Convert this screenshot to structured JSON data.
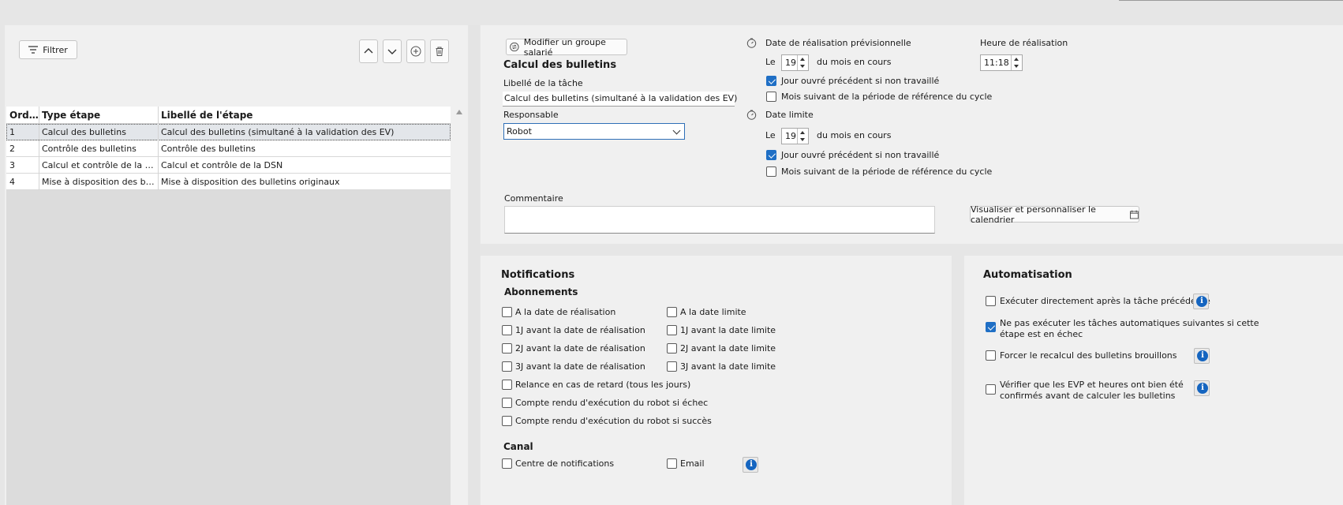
{
  "toolbar": {
    "filter_label": "Filtrer"
  },
  "grid": {
    "headers": [
      "Ordre",
      "Type étape",
      "Libellé de l'étape"
    ],
    "rows": [
      {
        "ordre": "1",
        "type": "Calcul des bulletins",
        "libelle": "Calcul des bulletins (simultané à la validation des EV)"
      },
      {
        "ordre": "2",
        "type": "Contrôle des bulletins",
        "libelle": "Contrôle des bulletins"
      },
      {
        "ordre": "3",
        "type": "Calcul et contrôle de la DSN",
        "libelle": "Calcul et contrôle de la DSN"
      },
      {
        "ordre": "4",
        "type": "Mise à disposition des bull...",
        "libelle": "Mise à disposition des bulletins originaux"
      }
    ]
  },
  "task": {
    "modify_group_label": "Modifier un groupe salarié",
    "title": "Calcul des bulletins",
    "libelle_label": "Libellé de la tâche",
    "libelle_value": "Calcul des bulletins (simultané à la validation des EV)",
    "responsable_label": "Responsable",
    "responsable_value": "Robot",
    "commentaire_label": "Commentaire",
    "date_prev_label": "Date de réalisation prévisionnelle",
    "le_label": "Le",
    "date_prev_day": "19",
    "du_mois_label": "du mois en cours",
    "jour_ouvre_label": "Jour ouvré précédent si non travaillé",
    "mois_suivant_label": "Mois suivant de la période de référence du cycle",
    "heure_label": "Heure de réalisation",
    "heure_value": "11:18",
    "date_limite_label": "Date limite",
    "date_limite_day": "19",
    "calendar_button_label": "Visualiser et personnaliser le calendrier"
  },
  "notifications": {
    "title": "Notifications",
    "abonnements_title": "Abonnements",
    "left_items": [
      {
        "label": "A la date de réalisation",
        "checked": false
      },
      {
        "label": "1J avant la date de réalisation",
        "checked": false
      },
      {
        "label": "2J avant la date de réalisation",
        "checked": false
      },
      {
        "label": "3J avant la date de réalisation",
        "checked": false
      },
      {
        "label": "Relance en cas de retard (tous les jours)",
        "checked": false
      },
      {
        "label": "Compte rendu d'exécution du robot si échec",
        "checked": false
      },
      {
        "label": "Compte rendu d'exécution du robot si succès",
        "checked": false
      }
    ],
    "right_items": [
      {
        "label": "A la date limite",
        "checked": false
      },
      {
        "label": "1J avant la date limite",
        "checked": false
      },
      {
        "label": "2J avant la date limite",
        "checked": false
      },
      {
        "label": "3J avant la date limite",
        "checked": false
      }
    ],
    "canal_title": "Canal",
    "canal_centre_label": "Centre de notifications",
    "canal_email_label": "Email"
  },
  "automatisation": {
    "title": "Automatisation",
    "item1_label": "Exécuter directement après la tâche précédente",
    "item2_line1": "Ne pas exécuter les tâches automatiques suivantes si cette",
    "item2_line2": "étape est en échec",
    "item3_label": "Forcer le recalcul des bulletins brouillons",
    "item4_line1": "Vérifier que les EVP et heures ont bien été",
    "item4_line2": "confirmés avant de calculer les bulletins"
  }
}
